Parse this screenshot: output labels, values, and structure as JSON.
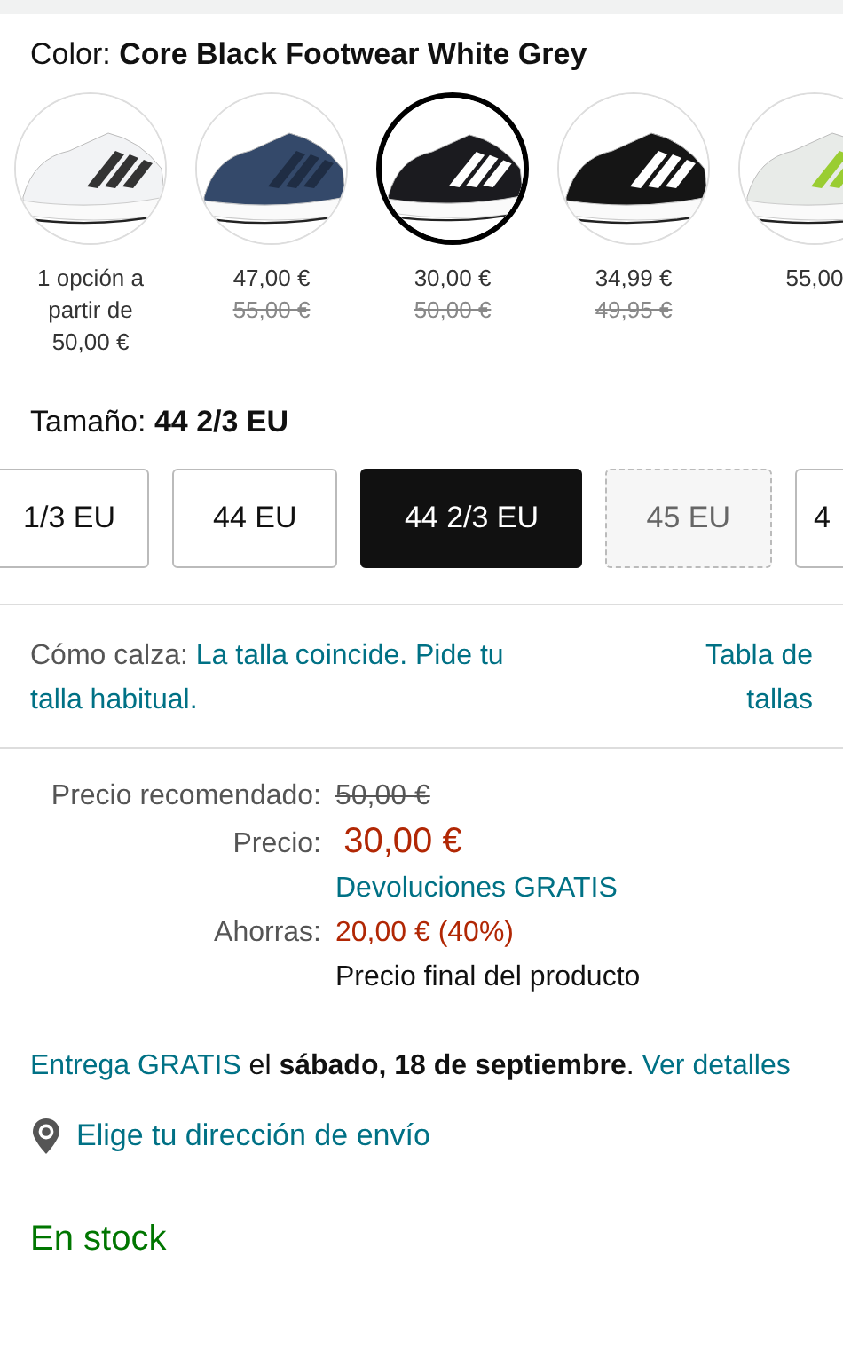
{
  "color": {
    "label": "Color:",
    "value": "Core Black Footwear White Grey"
  },
  "swatches": [
    {
      "price": "1 opción a partir de 50,00 €",
      "selected": false
    },
    {
      "price": "47,00 €",
      "list_price": "55,00 €",
      "selected": false
    },
    {
      "price": "30,00 €",
      "list_price": "50,00 €",
      "selected": true
    },
    {
      "price": "34,99 €",
      "list_price": "49,95 €",
      "selected": false
    },
    {
      "price": "55,00",
      "selected": false
    }
  ],
  "size": {
    "label": "Tamaño:",
    "value": "44 2/3 EU"
  },
  "sizes": [
    {
      "label": "1/3 EU",
      "selected": false,
      "available": true
    },
    {
      "label": "44 EU",
      "selected": false,
      "available": true
    },
    {
      "label": "44 2/3 EU",
      "selected": true,
      "available": true
    },
    {
      "label": "45 EU",
      "selected": false,
      "available": false
    },
    {
      "label": "4",
      "selected": false,
      "available": true
    }
  ],
  "fit": {
    "label": "Cómo calza:",
    "link": "La talla coincide. Pide tu talla habitual.",
    "chart_link": "Tabla de tallas"
  },
  "price_rows": [
    {
      "kind": "strike",
      "label": "Precio recomendado:",
      "value": "50,00 €"
    },
    {
      "kind": "price",
      "label": "Precio:",
      "value": "30,00 €"
    },
    {
      "kind": "link",
      "value": "Devoluciones GRATIS"
    },
    {
      "kind": "saving",
      "label": "Ahorras:",
      "value": "20,00 € (40%)"
    },
    {
      "kind": "plain",
      "value": "Precio final del producto"
    }
  ],
  "delivery": {
    "link": "Entrega GRATIS",
    "text": " el **sábado, 18 de septiembre**. ",
    "details_link": "Ver detalles"
  },
  "address_link": "Elige tu dirección de envío",
  "stock": "En stock"
}
